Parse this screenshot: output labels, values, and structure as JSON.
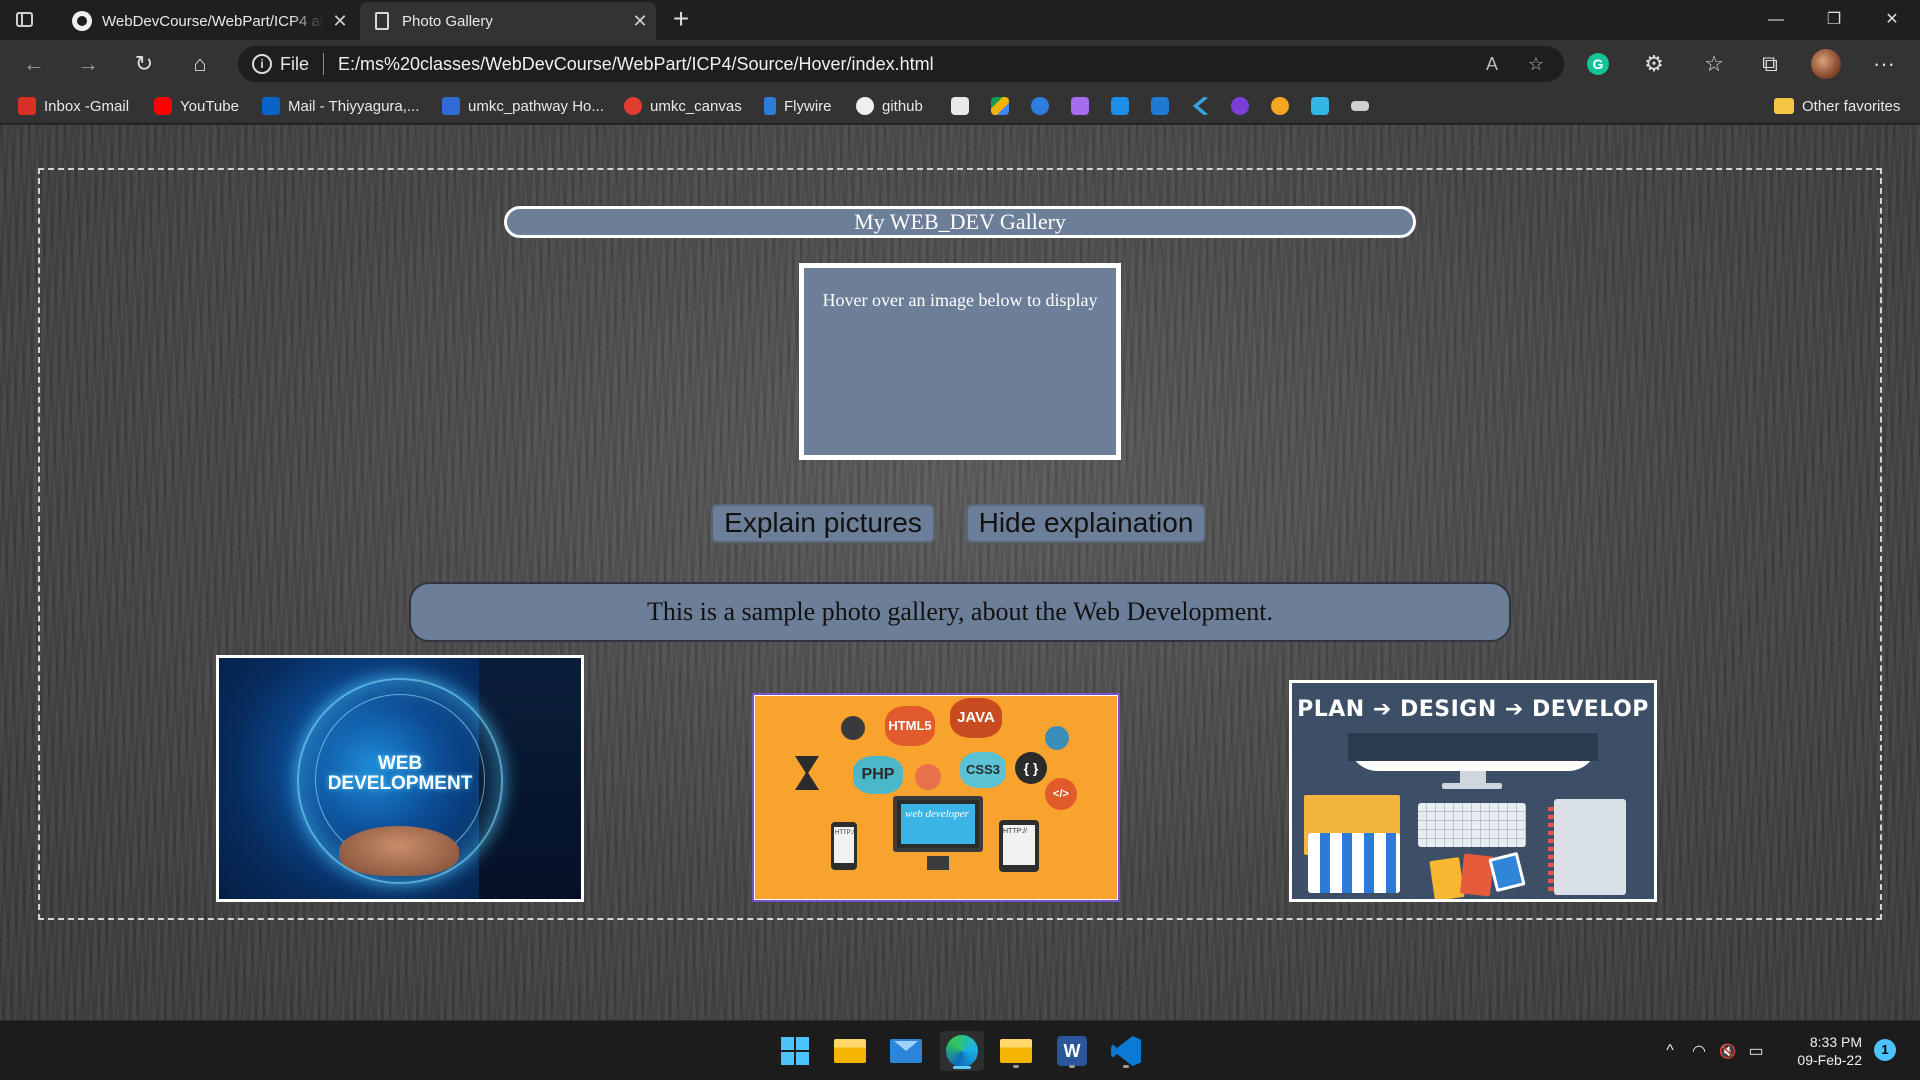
{
  "browser": {
    "tabs": [
      {
        "title": "WebDevCourse/WebPart/ICP4 at",
        "favicon": "github-icon"
      },
      {
        "title": "Photo Gallery",
        "favicon": "document-icon"
      }
    ],
    "new_tab_icon": "+",
    "window_controls": {
      "minimize": "—",
      "restore": "❐",
      "close": "✕"
    },
    "address": {
      "scheme": "File",
      "url": "E:/ms%20classes/WebDevCourse/WebPart/ICP4/Source/Hover/index.html"
    },
    "toolbar_icons": {
      "back": "←",
      "forward": "→",
      "refresh": "↻",
      "home": "⌂",
      "more": "···",
      "grammarly": "G"
    },
    "favorites": [
      {
        "label": "Inbox -Gmail",
        "icon": "gmail-icon",
        "color": "#d93025"
      },
      {
        "label": "YouTube",
        "icon": "youtube-icon",
        "color": "#ff0000"
      },
      {
        "label": "Mail - Thiyyagura,...",
        "icon": "outlook-icon",
        "color": "#0a64c8"
      },
      {
        "label": "umkc_pathway Ho...",
        "icon": "umkc-icon",
        "color": "#2f6bd6"
      },
      {
        "label": "umkc_canvas",
        "icon": "canvas-icon",
        "color": "#e13c2f"
      },
      {
        "label": "Flywire",
        "icon": "flywire-icon",
        "color": "#2b7fd8"
      },
      {
        "label": "github",
        "icon": "github-icon",
        "color": "#f0f0f0"
      }
    ],
    "favorites_icon_only": [
      {
        "icon": "trello-icon",
        "color": "#e8e8e8"
      },
      {
        "icon": "drive-icon",
        "color": "#f4b400"
      },
      {
        "icon": "s-app-icon",
        "color": "#2d7de0"
      },
      {
        "icon": "purple-app-icon",
        "color": "#a66cf0"
      },
      {
        "icon": "is-app-icon",
        "color": "#1d8de6"
      },
      {
        "icon": "linkedin-icon",
        "color": "#1f7bd1"
      },
      {
        "icon": "kotlin-icon",
        "color": "#36a3e0"
      },
      {
        "icon": "u-app-icon",
        "color": "#7b3fd9"
      },
      {
        "icon": "e-app-icon",
        "color": "#f5a623"
      },
      {
        "icon": "w-app-icon",
        "color": "#33b6e6"
      },
      {
        "icon": "edx-icon",
        "color": "#cfcfcf"
      }
    ],
    "other_favorites": "Other favorites"
  },
  "page": {
    "gallery_title": "My WEB_DEV Gallery",
    "display_text": "Hover over an image below to display",
    "buttons": {
      "explain": "Explain pictures",
      "hide": "Hide explaination"
    },
    "caption": "This is a sample photo gallery, about the Web Development.",
    "images": [
      {
        "alt": "web-development-image",
        "text": "WEB\nDEVELOPMENT"
      },
      {
        "alt": "web-developer-languages-image",
        "tags": [
          "HTML5",
          "JAVA",
          "PHP",
          "CSS3",
          "{ }",
          "</>",
          "web developer",
          "HTTP://",
          "HTTP://"
        ]
      },
      {
        "alt": "plan-design-develop-image",
        "text": "PLAN ➔ DESIGN ➔ DEVELOP"
      }
    ]
  },
  "taskbar": {
    "apps": [
      "start-icon",
      "file-explorer-icon",
      "mail-icon",
      "edge-icon",
      "folder-icon",
      "word-icon",
      "vscode-icon"
    ],
    "word_letter": "W",
    "tray": {
      "chevron": "^",
      "wifi": "wifi-icon",
      "volume": "🔇",
      "battery": "battery-icon"
    },
    "time": "8:33 PM",
    "date": "09-Feb-22",
    "notifications": "1"
  }
}
